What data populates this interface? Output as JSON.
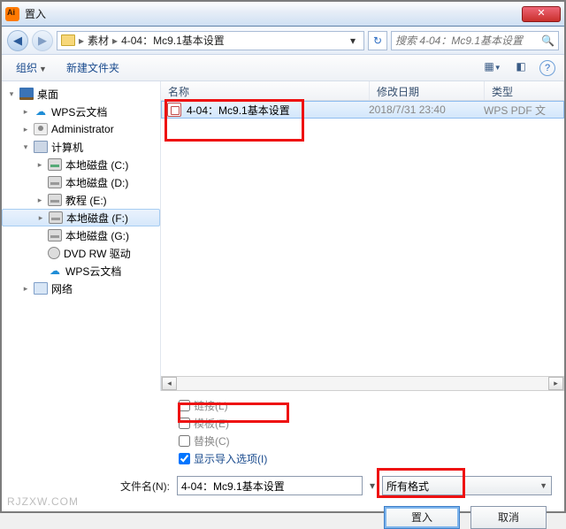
{
  "window": {
    "title": "置入"
  },
  "breadcrumb": {
    "seg1": "素材",
    "seg2": "4-04：Mc9.1基本设置"
  },
  "search": {
    "placeholder": "搜索 4-04：Mc9.1基本设置"
  },
  "toolbar": {
    "organize": "组织",
    "new_folder": "新建文件夹"
  },
  "columns": {
    "name": "名称",
    "date": "修改日期",
    "type": "类型"
  },
  "tree": {
    "desktop": "桌面",
    "wps1": "WPS云文档",
    "admin": "Administrator",
    "computer": "计算机",
    "driveC": "本地磁盘 (C:)",
    "driveD": "本地磁盘 (D:)",
    "driveE": "教程 (E:)",
    "driveF": "本地磁盘 (F:)",
    "driveG": "本地磁盘 (G:)",
    "dvd": "DVD RW 驱动",
    "wps2": "WPS云文档",
    "network": "网络"
  },
  "files": [
    {
      "name": "4-04：Mc9.1基本设置",
      "date": "2018/7/31 23:40",
      "type": "WPS PDF 文"
    }
  ],
  "options": {
    "link": "链接(L)",
    "template": "模板(E)",
    "replace": "替换(C)",
    "show_import": "显示导入选项(I)"
  },
  "filename": {
    "label": "文件名(N):",
    "value": "4-04：Mc9.1基本设置"
  },
  "format": {
    "label": "所有格式"
  },
  "buttons": {
    "place": "置入",
    "cancel": "取消"
  },
  "watermark": "RJZXW.COM"
}
